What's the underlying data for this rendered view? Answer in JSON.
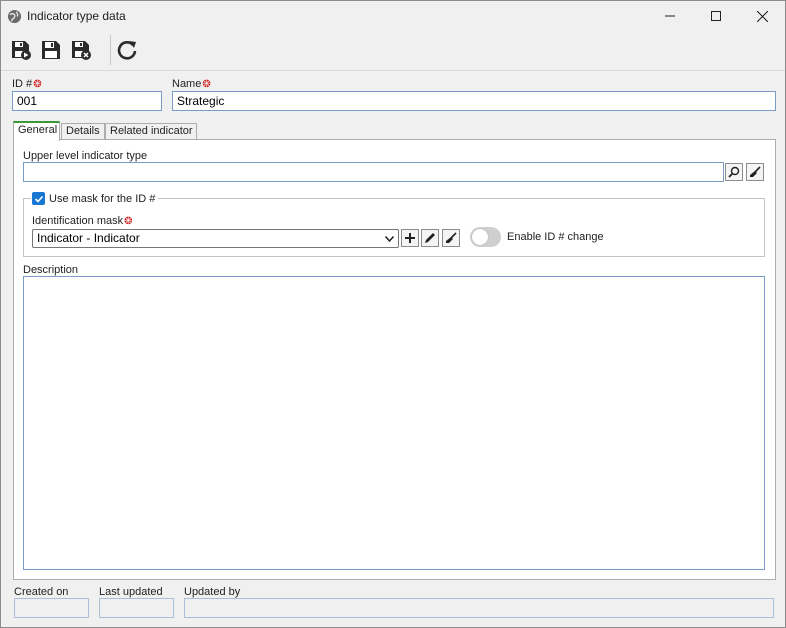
{
  "window": {
    "title": "Indicator type data",
    "controls": [
      "minimize",
      "maximize",
      "close"
    ]
  },
  "toolbar": {
    "buttons": [
      {
        "name": "save-and-new",
        "icon": "floppy-plus-icon"
      },
      {
        "name": "save",
        "icon": "floppy-icon"
      },
      {
        "name": "save-and-close",
        "icon": "floppy-close-icon"
      },
      {
        "name": "refresh",
        "icon": "refresh-icon"
      }
    ]
  },
  "form": {
    "id_label": "ID #",
    "id_value": "001",
    "name_label": "Name",
    "name_value": "Strategic",
    "required_marker_color": "#d01818"
  },
  "tabs": [
    {
      "label": "General",
      "active": true
    },
    {
      "label": "Details",
      "active": false
    },
    {
      "label": "Related indicator",
      "active": false
    }
  ],
  "general": {
    "upper_level_label": "Upper level indicator type",
    "upper_level_value": "",
    "use_mask_label": "Use mask for the ID #",
    "use_mask_checked": true,
    "identification_mask_label": "Identification mask",
    "identification_mask_value": "Indicator - Indicator",
    "enable_id_change_label": "Enable ID # change",
    "enable_id_change_on": false,
    "description_label": "Description",
    "description_value": ""
  },
  "footer": {
    "created_on_label": "Created on",
    "created_on_value": "",
    "last_updated_label": "Last updated",
    "last_updated_value": "",
    "updated_by_label": "Updated by",
    "updated_by_value": ""
  },
  "colors": {
    "accent": "#1976d2",
    "active_tab": "#3a9a3a",
    "field_border": "#7a9cc6"
  }
}
